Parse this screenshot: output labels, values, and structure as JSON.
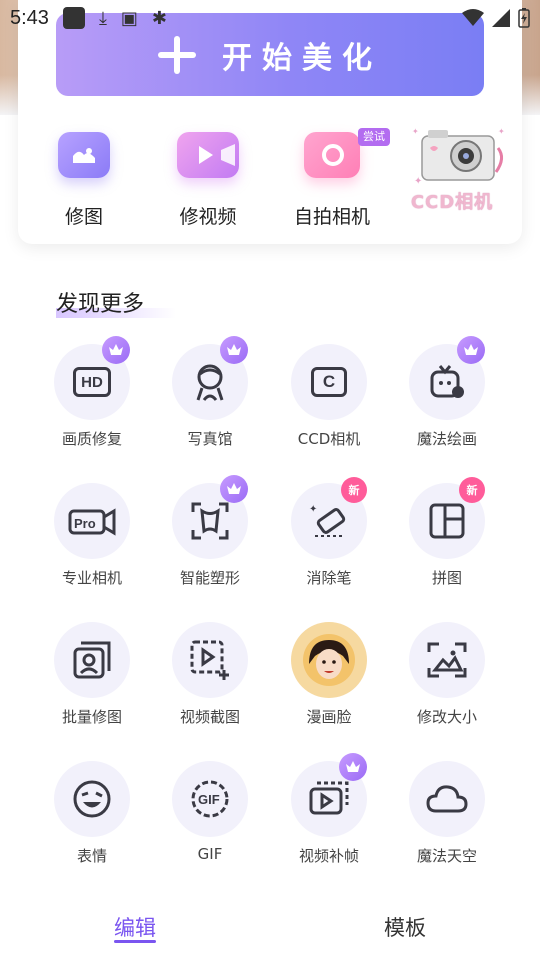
{
  "status_bar": {
    "time": "5:43"
  },
  "hero": {
    "beautify_label": "开始美化"
  },
  "quick_actions": [
    {
      "label": "修图",
      "icon": "photo-edit-icon"
    },
    {
      "label": "修视频",
      "icon": "video-edit-icon"
    },
    {
      "label": "自拍相机",
      "icon": "selfie-camera-icon",
      "badge": "尝试"
    },
    {
      "label": "CCD相机",
      "icon": "ccd-camera-illustration"
    }
  ],
  "discover": {
    "title": "发现更多",
    "tools": [
      {
        "label": "画质修复",
        "icon": "hd-icon",
        "badge": "crown"
      },
      {
        "label": "写真馆",
        "icon": "portrait-studio-icon",
        "badge": "crown"
      },
      {
        "label": "CCD相机",
        "icon": "ccd-camera-icon"
      },
      {
        "label": "魔法绘画",
        "icon": "magic-paint-icon",
        "badge": "crown"
      },
      {
        "label": "专业相机",
        "icon": "pro-camera-icon"
      },
      {
        "label": "智能塑形",
        "icon": "body-shape-icon",
        "badge": "crown"
      },
      {
        "label": "消除笔",
        "icon": "eraser-icon",
        "badge": "新"
      },
      {
        "label": "拼图",
        "icon": "collage-icon",
        "badge": "新"
      },
      {
        "label": "批量修图",
        "icon": "batch-edit-icon"
      },
      {
        "label": "视频截图",
        "icon": "video-screenshot-icon"
      },
      {
        "label": "漫画脸",
        "icon": "comic-face-avatar"
      },
      {
        "label": "修改大小",
        "icon": "resize-icon"
      },
      {
        "label": "表情",
        "icon": "emoji-icon"
      },
      {
        "label": "GIF",
        "icon": "gif-icon"
      },
      {
        "label": "视频补帧",
        "icon": "frame-interpolation-icon",
        "badge": "crown"
      },
      {
        "label": "魔法天空",
        "icon": "magic-sky-icon"
      }
    ]
  },
  "bottom_nav": {
    "tabs": [
      {
        "label": "编辑",
        "active": true
      },
      {
        "label": "模板",
        "active": false
      }
    ]
  },
  "colors": {
    "accent": "#7a55f0",
    "button_gradient_start": "#b89cf7",
    "button_gradient_end": "#7a7ef4",
    "new_badge": "#ff5c9a"
  }
}
